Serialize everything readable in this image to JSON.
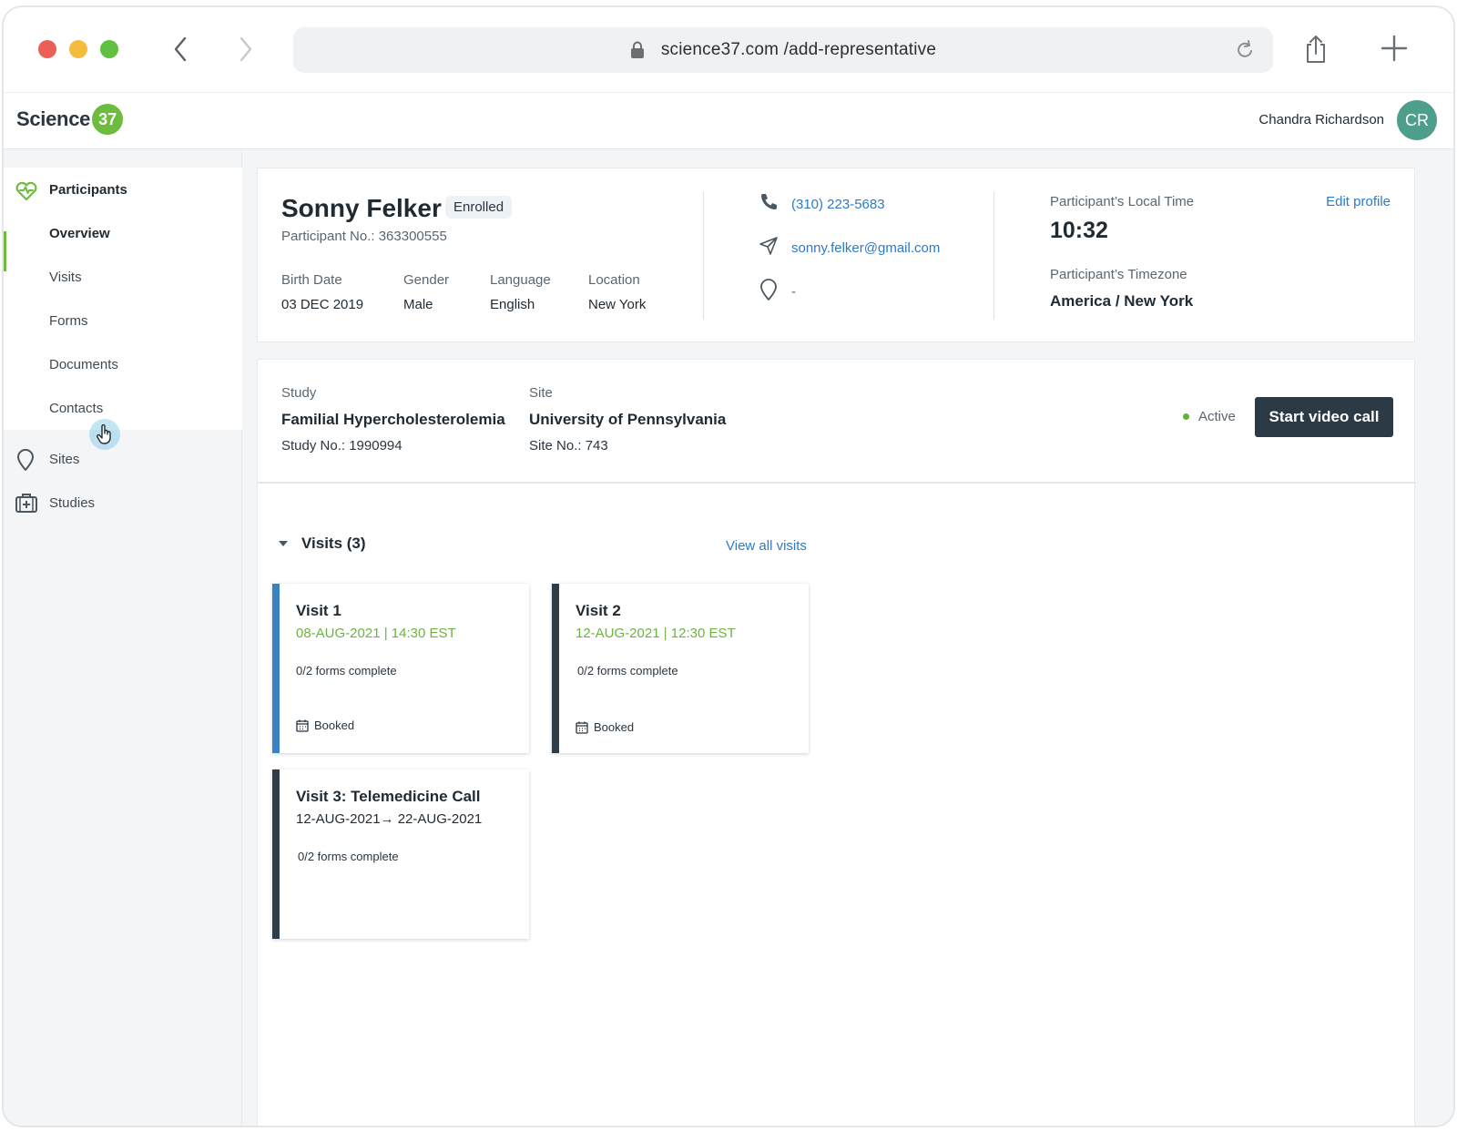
{
  "browser": {
    "url": "science37.com /add-representative"
  },
  "header": {
    "logo_text": "Science",
    "logo_badge": "37",
    "user_name": "Chandra Richardson",
    "user_initials": "CR"
  },
  "sidebar": {
    "section": "Participants",
    "items": [
      {
        "label": "Overview",
        "active": true
      },
      {
        "label": "Visits"
      },
      {
        "label": "Forms"
      },
      {
        "label": "Documents"
      },
      {
        "label": "Contacts"
      }
    ],
    "sites": "Sites",
    "studies": "Studies"
  },
  "participant": {
    "name": "Sonny Felker",
    "status_badge": "Enrolled",
    "number": "Participant No.: 363300555",
    "birth_date_label": "Birth Date",
    "birth_date": "03 DEC 2019",
    "gender_label": "Gender",
    "gender": "Male",
    "language_label": "Language",
    "language": "English",
    "location_label": "Location",
    "location": "New York",
    "phone": "(310) 223-5683",
    "email": "sonny.felker@gmail.com",
    "address": "-",
    "local_time_label": "Participant’s Local Time",
    "local_time": "10:32",
    "timezone_label": "Participant’s Timezone",
    "timezone": "America / New York",
    "edit_label": "Edit profile"
  },
  "study": {
    "study_label": "Study",
    "study_name": "Familial Hypercholesterolemia",
    "study_no": "Study No.: 1990994",
    "site_label": "Site",
    "site_name": "University of Pennsylvania",
    "site_no": "Site No.: 743",
    "status": "Active",
    "video_button": "Start video call"
  },
  "visits": {
    "title": "Visits (3)",
    "view_all": "View all visits",
    "cards": [
      {
        "title": "Visit 1",
        "date": "08-AUG-2021  |  14:30 EST",
        "forms": "0/2 forms complete",
        "status": "Booked"
      },
      {
        "title": "Visit 2",
        "date": "12-AUG-2021  |  12:30 EST",
        "forms": "0/2 forms complete",
        "status": "Booked"
      },
      {
        "title": "Visit 3: Telemedicine Call",
        "date": "12-AUG-2021→ 22-AUG-2021",
        "forms": "0/2 forms complete"
      }
    ]
  },
  "colors": {
    "brand_green": "#6dbb3f",
    "link_blue": "#2d7ac8",
    "button_dark": "#2b3a44",
    "visit_blue": "#3b82c4"
  }
}
